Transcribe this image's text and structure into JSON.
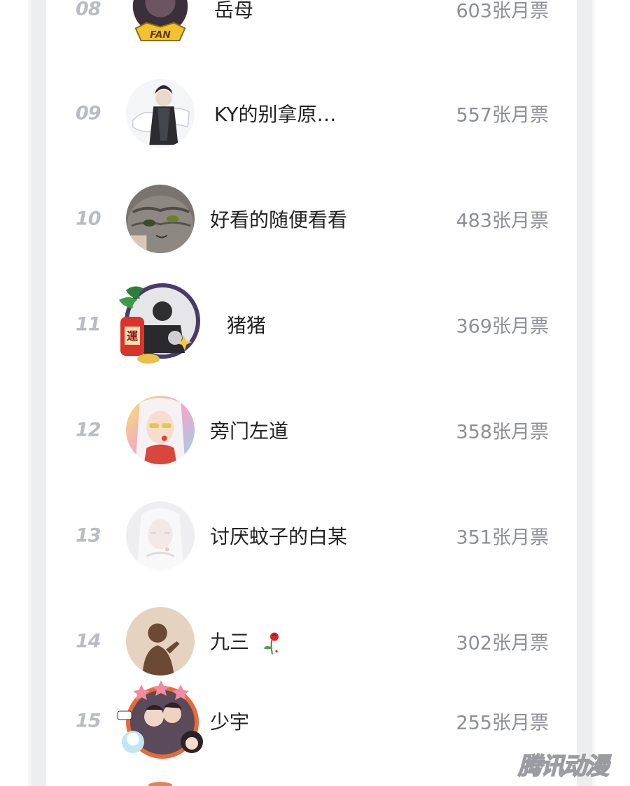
{
  "ranking": {
    "ticket_suffix": "张月票",
    "rows": [
      {
        "rank": "08",
        "name": "岳母",
        "tickets": "603张月票",
        "avatar": "fan-frame-avatar-icon"
      },
      {
        "rank": "09",
        "name": "KY的别拿原…",
        "tickets": "557张月票",
        "avatar": "swordsman-avatar-icon"
      },
      {
        "rank": "10",
        "name": "好看的随便看看",
        "tickets": "483张月票",
        "avatar": "cat-avatar-icon"
      },
      {
        "rank": "11",
        "name": "猪猪",
        "tickets": "369张月票",
        "avatar": "luck-frame-avatar-icon"
      },
      {
        "rank": "12",
        "name": "旁门左道",
        "tickets": "358张月票",
        "avatar": "rainbow-girl-avatar-icon"
      },
      {
        "rank": "13",
        "name": "讨厌蚊子的白某",
        "tickets": "351张月票",
        "avatar": "pale-avatar-icon"
      },
      {
        "rank": "14",
        "name": "九三",
        "tickets": "302张月票",
        "avatar": "silhouette-avatar-icon",
        "emoji": "rose-icon"
      },
      {
        "rank": "15",
        "name": "少宇",
        "tickets": "255张月票",
        "avatar": "star-frame-avatar-icon"
      }
    ]
  },
  "watermark": "腾讯动漫",
  "colors": {
    "rank": "#b9bcc2",
    "name": "#222222",
    "tickets": "#8c8f95",
    "side": "#eceef2"
  }
}
